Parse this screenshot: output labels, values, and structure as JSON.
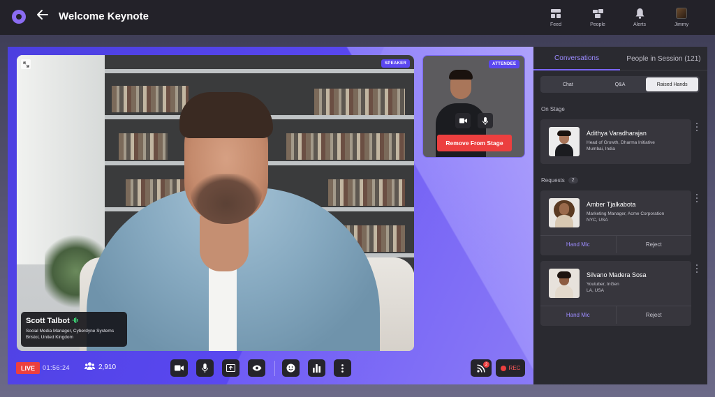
{
  "header": {
    "title": "Welcome Keynote",
    "nav": [
      {
        "label": "Feed",
        "icon": "feed-icon"
      },
      {
        "label": "People",
        "icon": "people-icon"
      },
      {
        "label": "Alerts",
        "icon": "bell-icon"
      },
      {
        "label": "Jimmy",
        "icon": "avatar"
      }
    ]
  },
  "stage": {
    "speaker_badge": "SPEAKER",
    "speaker": {
      "name": "Scott Talbot",
      "title": "Social Media Manager, Cyberdyne Systems",
      "location": "Bristol, United Kingdom"
    },
    "attendee_badge": "ATTENDEE",
    "remove_label": "Remove From Stage"
  },
  "controls": {
    "live_label": "LIVE",
    "timer": "01:56:24",
    "viewers": "2,910",
    "rss_count": "2",
    "rec_label": "REC"
  },
  "panel": {
    "tabs": [
      "Conversations",
      "People in Session (121)"
    ],
    "segments": [
      "Chat",
      "Q&A",
      "Raised Hands"
    ],
    "active_segment": "Raised Hands",
    "on_stage_label": "On Stage",
    "on_stage": {
      "name": "Adithya Varadharajan",
      "title": "Head of Growth, Dharma Initiative",
      "location": "Mumbai, India"
    },
    "requests_label": "Requests",
    "requests_count": "2",
    "requests": [
      {
        "name": "Amber Tjalkabota",
        "title": "Marketing Manager, Acme Corporation",
        "location": "NYC, USA",
        "accept_label": "Hand Mic",
        "reject_label": "Reject"
      },
      {
        "name": "Silvano Madera Sosa",
        "title": "Youtuber, InGen",
        "location": "LA, USA",
        "accept_label": "Hand Mic",
        "reject_label": "Reject"
      }
    ]
  },
  "colors": {
    "accent": "#7c67ff",
    "live_red": "#ec3f3f",
    "stage_purple": "#5a48f0",
    "panel_bg": "#2a2a30"
  }
}
